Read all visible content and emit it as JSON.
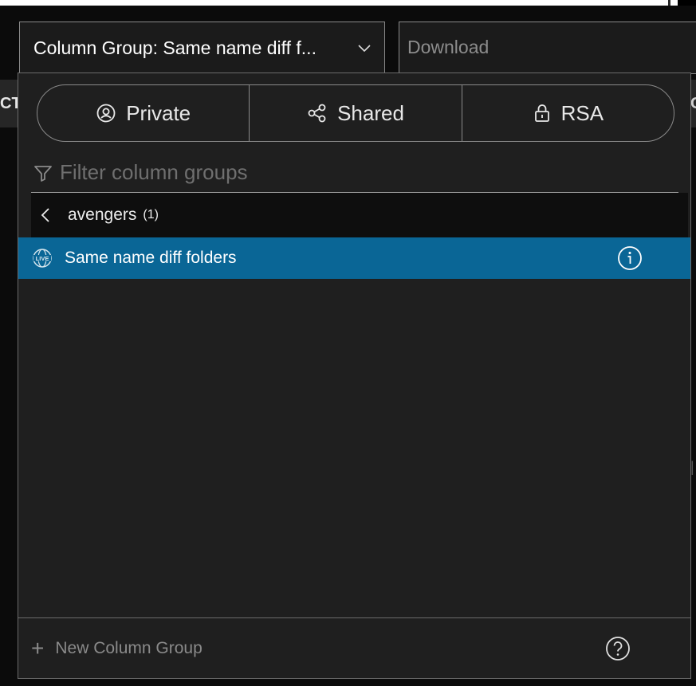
{
  "column_group_select": {
    "label": "Column Group: Same name diff f...",
    "icon": "chevron-down-icon"
  },
  "download": {
    "label": "Download"
  },
  "background_toolbar": {
    "left_text": "CT",
    "right_text": "C",
    "side_mark": "|"
  },
  "tabs": [
    {
      "label": "Private",
      "icon": "user-circle-icon"
    },
    {
      "label": "Shared",
      "icon": "share-icon"
    },
    {
      "label": "RSA",
      "icon": "lock-icon"
    }
  ],
  "filter": {
    "placeholder": "Filter column groups",
    "icon": "filter-icon"
  },
  "folder": {
    "name": "avengers",
    "count": "(1)",
    "icon": "chevron-left-icon"
  },
  "items": [
    {
      "name": "Same name diff folders",
      "badge_icon": "live-globe-icon",
      "info_icon": "info-icon"
    }
  ],
  "footer": {
    "new_label": "New Column Group",
    "plus": "+",
    "help_icon": "help-icon"
  },
  "colors": {
    "selected_row": "#0a6696",
    "panel_bg": "#1f1f1f",
    "folder_row_bg": "#0e0e0e"
  }
}
